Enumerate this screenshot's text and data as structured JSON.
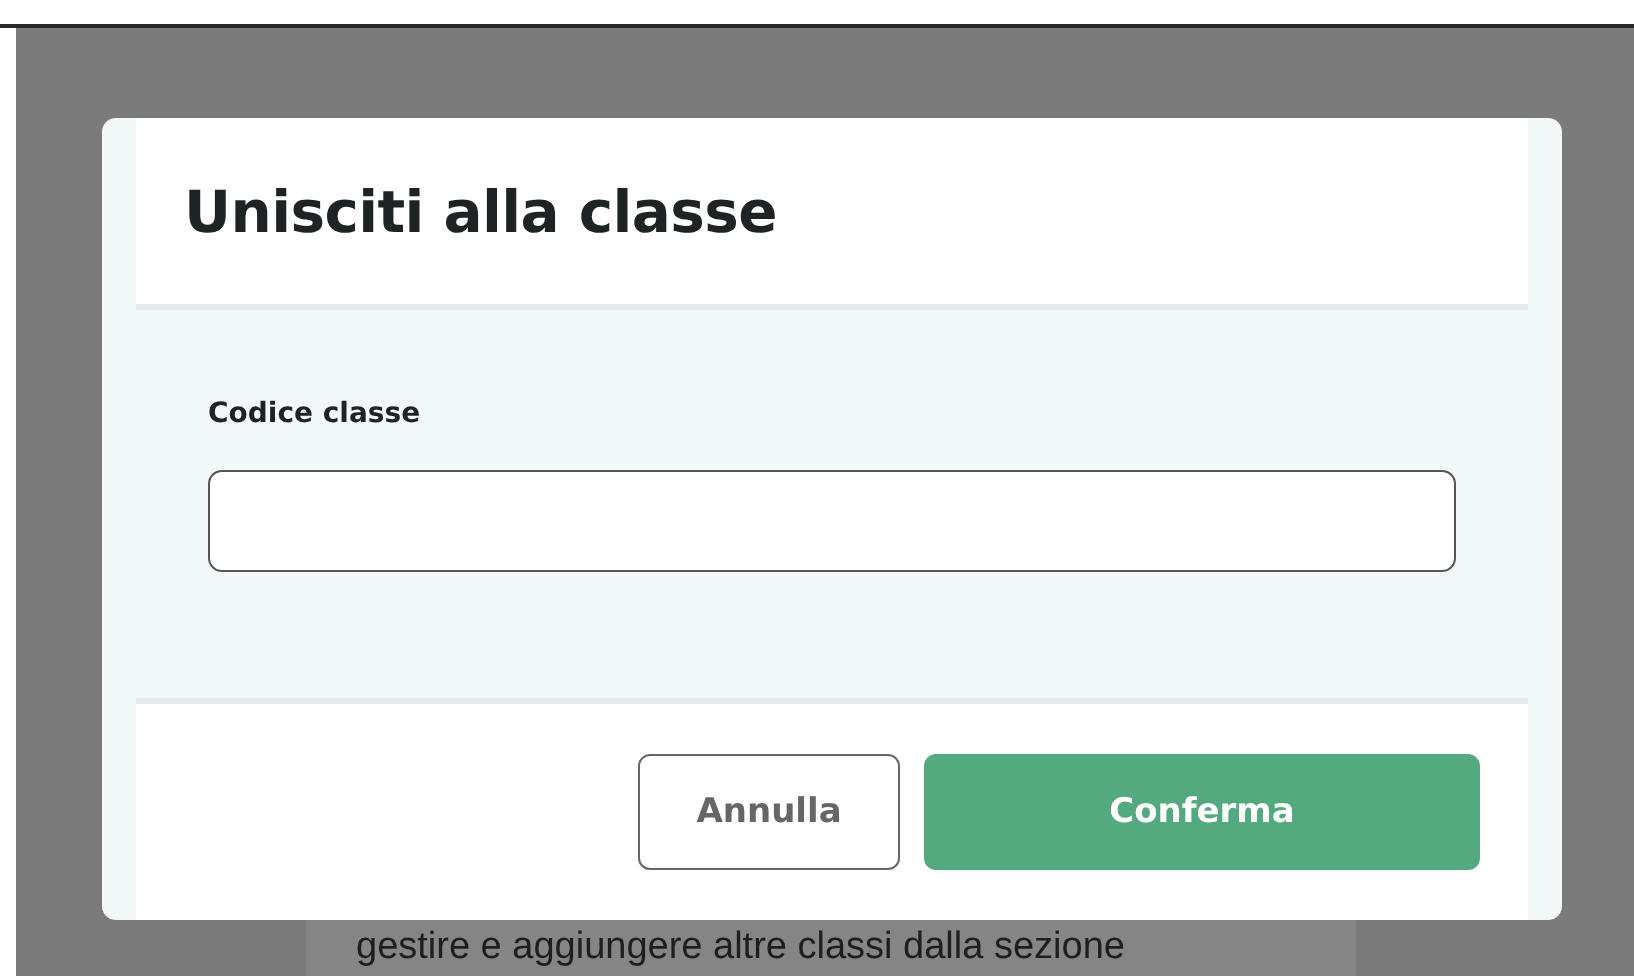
{
  "background": {
    "text": "gestire e aggiungere altre classi dalla sezione"
  },
  "dialog": {
    "title": "Unisciti alla classe",
    "field": {
      "label": "Codice classe"
    },
    "buttons": [
      {
        "label": "Annulla",
        "kind": "secondary"
      },
      {
        "label": "Conferma",
        "kind": "primary"
      }
    ]
  }
}
